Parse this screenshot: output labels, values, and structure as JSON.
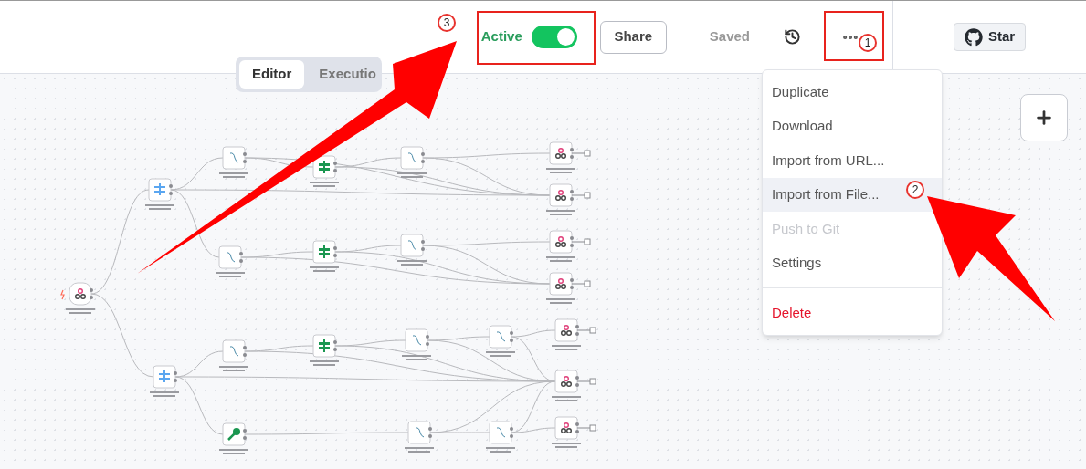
{
  "header": {
    "active_toggle": {
      "label": "Active",
      "on": true
    },
    "share_button": "Share",
    "save_status": "Saved",
    "star_button": "Star"
  },
  "view_tabs": [
    {
      "label": "Editor",
      "selected": true
    },
    {
      "label": "Executio",
      "selected": false
    }
  ],
  "workflow_menu": {
    "groups": [
      [
        {
          "label": "Duplicate",
          "selected": false,
          "disabled": false,
          "kind": "normal"
        },
        {
          "label": "Download",
          "selected": false,
          "disabled": false,
          "kind": "normal"
        },
        {
          "label": "Import from URL...",
          "selected": false,
          "disabled": false,
          "kind": "normal"
        },
        {
          "label": "Import from File...",
          "selected": true,
          "disabled": false,
          "kind": "normal"
        },
        {
          "label": "Push to Git",
          "selected": false,
          "disabled": true,
          "kind": "normal"
        },
        {
          "label": "Settings",
          "selected": false,
          "disabled": false,
          "kind": "normal"
        }
      ],
      [
        {
          "label": "Delete",
          "selected": false,
          "disabled": false,
          "kind": "danger"
        }
      ]
    ]
  },
  "annotation_markers": [
    "3",
    "1",
    "2"
  ]
}
